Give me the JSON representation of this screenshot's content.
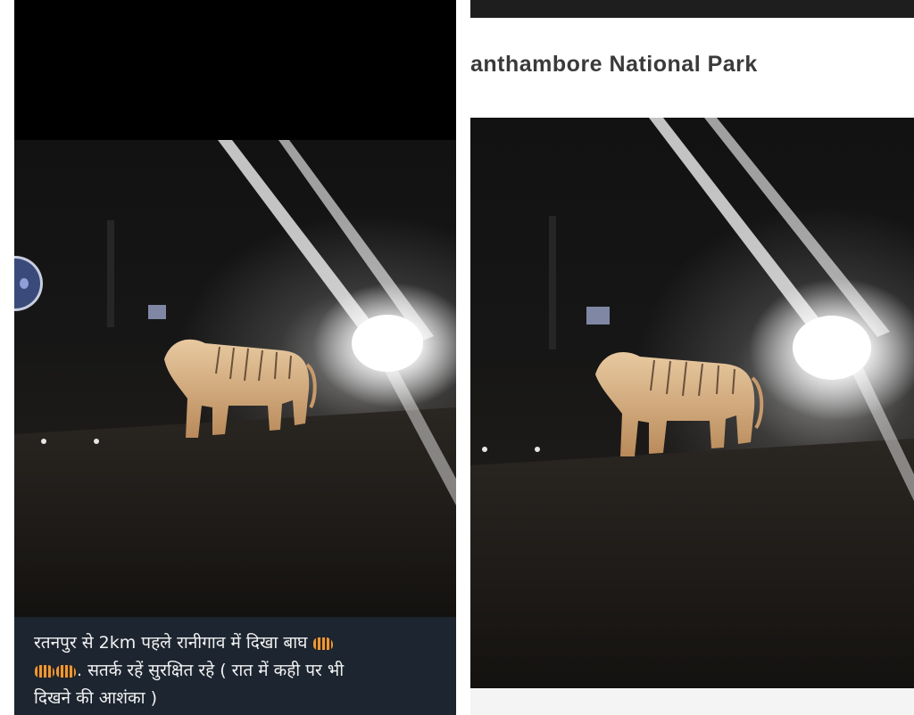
{
  "left_post": {
    "caption_line_1": "रतनपुर से 2km पहले रानीगाव में दिखा बाघ",
    "caption_line_2": ". सतर्क रहें सुरक्षित रहे ( रात में कही पर  भी",
    "caption_line_3": "दिखने की आशंका )",
    "emoji_icon": "tiger-emoji-icon",
    "colors": {
      "caption_background": "#1c2530",
      "caption_text": "#f2f2f2"
    }
  },
  "right_post": {
    "title": "anthambore National Park",
    "colors": {
      "title_text": "#3a3a3a",
      "top_bar": "#1e1e1e"
    }
  }
}
